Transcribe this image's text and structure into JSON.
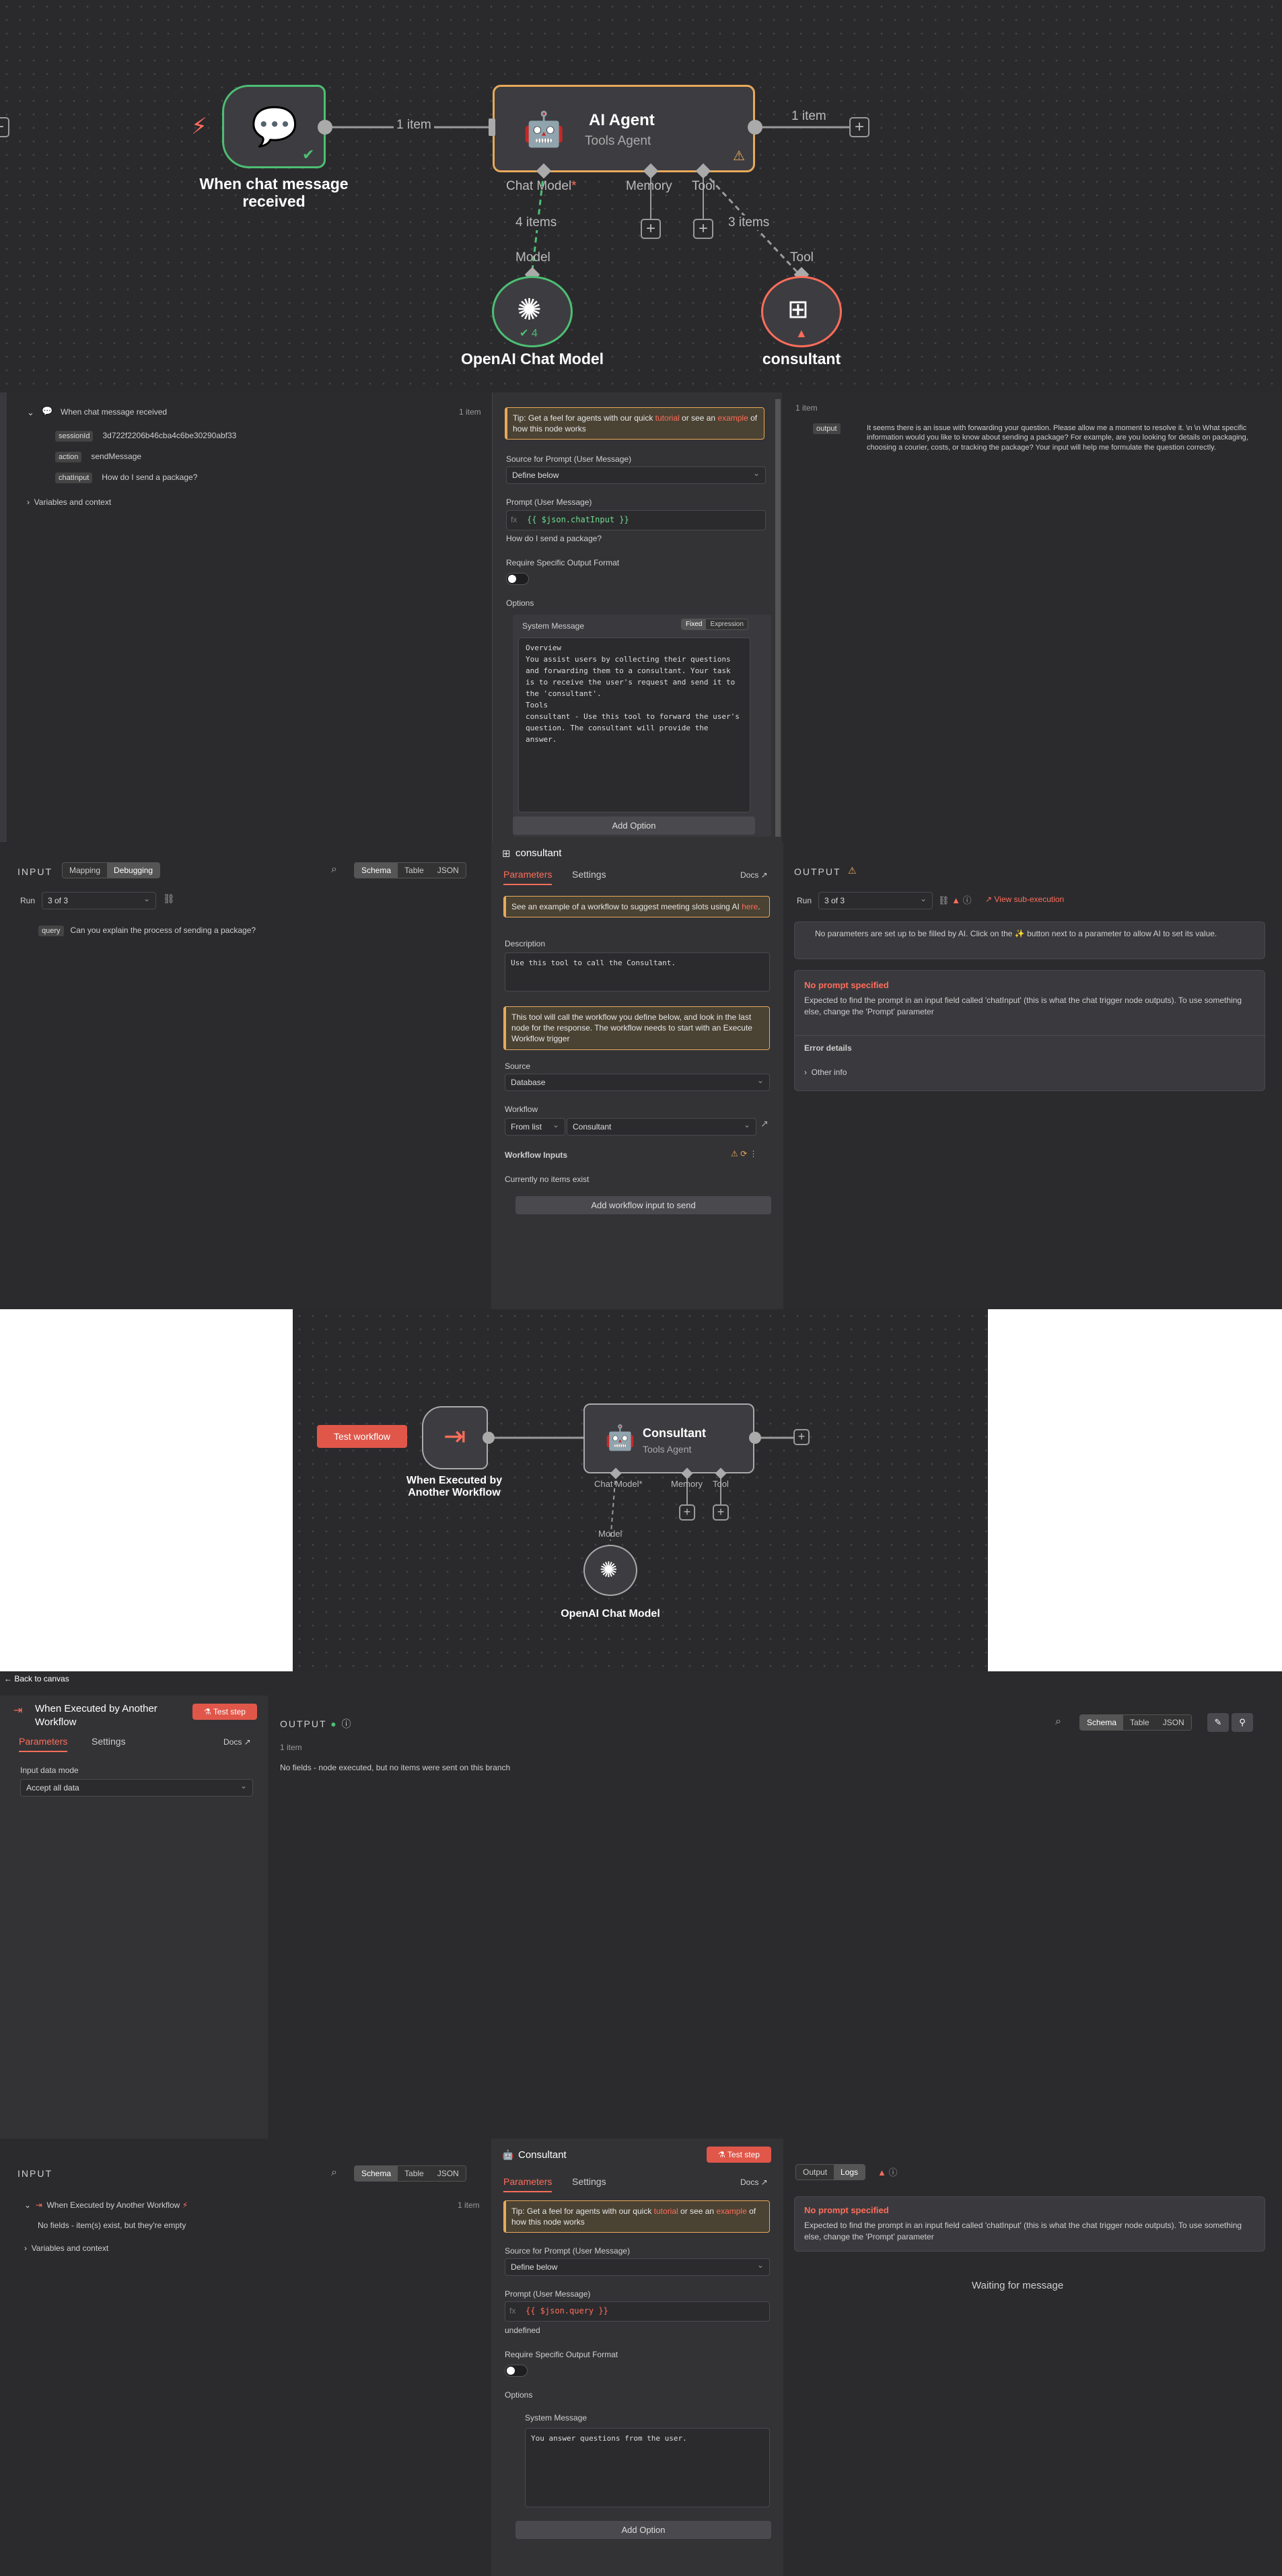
{
  "canvas1": {
    "trigger_title": "When chat message received",
    "agent_title": "AI Agent",
    "agent_sub": "Tools Agent",
    "edge1": "1 item",
    "edge2": "1 item",
    "port_chat": "Chat Model",
    "port_chat_req": "*",
    "port_memory": "Memory",
    "port_tool": "Tool",
    "items4": "4 items",
    "items3": "3 items",
    "model_lbl": "Model",
    "tool_lbl": "Tool",
    "openai_title": "OpenAI Chat Model",
    "openai_badge": "4",
    "consultant_title": "consultant"
  },
  "panel2": {
    "trigger": "When chat message received",
    "count": "1 item",
    "rows": [
      {
        "key": "sessionId",
        "val": "3d722f2206b46cba4c6be30290abf33"
      },
      {
        "key": "action",
        "val": "sendMessage"
      },
      {
        "key": "chatInput",
        "val": "How do I send a package?"
      }
    ],
    "vars": "Variables and context",
    "tip": "Tip: Get a feel for agents with our quick ",
    "tip_link1": "tutorial",
    "tip_mid": " or see an ",
    "tip_link2": "example",
    "tip_end": " of how this node works",
    "source_lbl": "Source for Prompt (User Message)",
    "source_val": "Define below",
    "prompt_lbl": "Prompt (User Message)",
    "prompt_expr": "{{ $json.chatInput }}",
    "prompt_result": "How do I send a package?",
    "format_lbl": "Require Specific Output Format",
    "options": "Options",
    "sysmsg_lbl": "System Message",
    "fixed": "Fixed",
    "expression": "Expression",
    "sysmsg": "Overview\nYou assist users by collecting their questions\nand forwarding them to a consultant. Your task\nis to receive the user's request and send it to\nthe 'consultant'.\nTools\nconsultant - Use this tool to forward the user's\nquestion. The consultant will provide the\nanswer.",
    "add_option": "Add Option",
    "out_count": "1 item",
    "out_key": "output",
    "out_val": "It seems there is an issue with forwarding your question. Please allow me a moment to resolve it. \\n \\n What specific information would you like to know about sending a package? For example, are you looking for details on packaging, choosing a courier, costs, or tracking the package? Your input will help me formulate the question correctly."
  },
  "panel3": {
    "input": "INPUT",
    "mapping": "Mapping",
    "debugging": "Debugging",
    "views": [
      "Schema",
      "Table",
      "JSON"
    ],
    "run": "Run",
    "run_val": "3 of 3",
    "query_key": "query",
    "query_val": "Can you explain the process of sending a package?",
    "node": "consultant",
    "tab_params": "Parameters",
    "tab_settings": "Settings",
    "docs": "Docs",
    "tip": "See an example of a workflow to suggest meeting slots using AI ",
    "tip_link": "here",
    "desc_lbl": "Description",
    "desc_val": "Use this tool to call the Consultant.",
    "warn": "This tool will call the workflow you define below, and look in the last node for the response. The workflow needs to start with an Execute Workflow trigger",
    "source_lbl": "Source",
    "source_val": "Database",
    "wf_lbl": "Workflow",
    "wf_mode": "From list",
    "wf_val": "Consultant",
    "inputs_lbl": "Workflow Inputs",
    "no_items": "Currently no items exist",
    "add_input": "Add workflow input to send",
    "output": "OUTPUT",
    "view_sub": "View sub-execution",
    "info": "No parameters are set up to be filled by AI. Click on the ✨ button next to a parameter to allow AI to set its value.",
    "err_title": "No prompt specified",
    "err_body": "Expected to find the prompt in an input field called 'chatInput' (this is what the chat trigger node outputs). To use something else, change the 'Prompt' parameter",
    "err_details": "Error details",
    "other_info": "Other info"
  },
  "canvas4": {
    "test": "Test workflow",
    "trigger": "When Executed by Another Workflow",
    "agent": "Consultant",
    "agent_sub": "Tools Agent",
    "port_chat": "Chat Model*",
    "port_memory": "Memory",
    "port_tool": "Tool",
    "model_lbl": "Model",
    "openai": "OpenAI Chat Model"
  },
  "panel5": {
    "back": "Back to canvas",
    "node": "When Executed by Another Workflow",
    "test_step": "Test step",
    "tab_params": "Parameters",
    "tab_settings": "Settings",
    "docs": "Docs",
    "mode_lbl": "Input data mode",
    "mode_val": "Accept all data",
    "output": "OUTPUT",
    "count": "1 item",
    "empty": "No fields - node executed, but no items were sent on this branch",
    "views": [
      "Schema",
      "Table",
      "JSON"
    ]
  },
  "panel6": {
    "input": "INPUT",
    "views": [
      "Schema",
      "Table",
      "JSON"
    ],
    "trigger": "When Executed by Another Workflow",
    "count": "1 item",
    "nofields": "No fields - item(s) exist, but they're empty",
    "vars": "Variables and context",
    "node": "Consultant",
    "test_step": "Test step",
    "tab_params": "Parameters",
    "tab_settings": "Settings",
    "docs": "Docs",
    "tip": "Tip: Get a feel for agents with our quick ",
    "tip_link1": "tutorial",
    "tip_mid": " or see an ",
    "tip_link2": "example",
    "tip_end": " of how this node works",
    "source_lbl": "Source for Prompt (User Message)",
    "source_val": "Define below",
    "prompt_lbl": "Prompt (User Message)",
    "prompt_expr": "{{ $json.query }}",
    "prompt_result": "undefined",
    "format_lbl": "Require Specific Output Format",
    "options": "Options",
    "sysmsg_lbl": "System Message",
    "sysmsg": "You answer questions from the user.",
    "add_option": "Add Option",
    "out_tab": "Output",
    "logs_tab": "Logs",
    "err_title": "No prompt specified",
    "err_body": "Expected to find the prompt in an input field called 'chatInput' (this is what the chat trigger node outputs). To use something else, change the 'Prompt' parameter",
    "waiting": "Waiting for message"
  }
}
